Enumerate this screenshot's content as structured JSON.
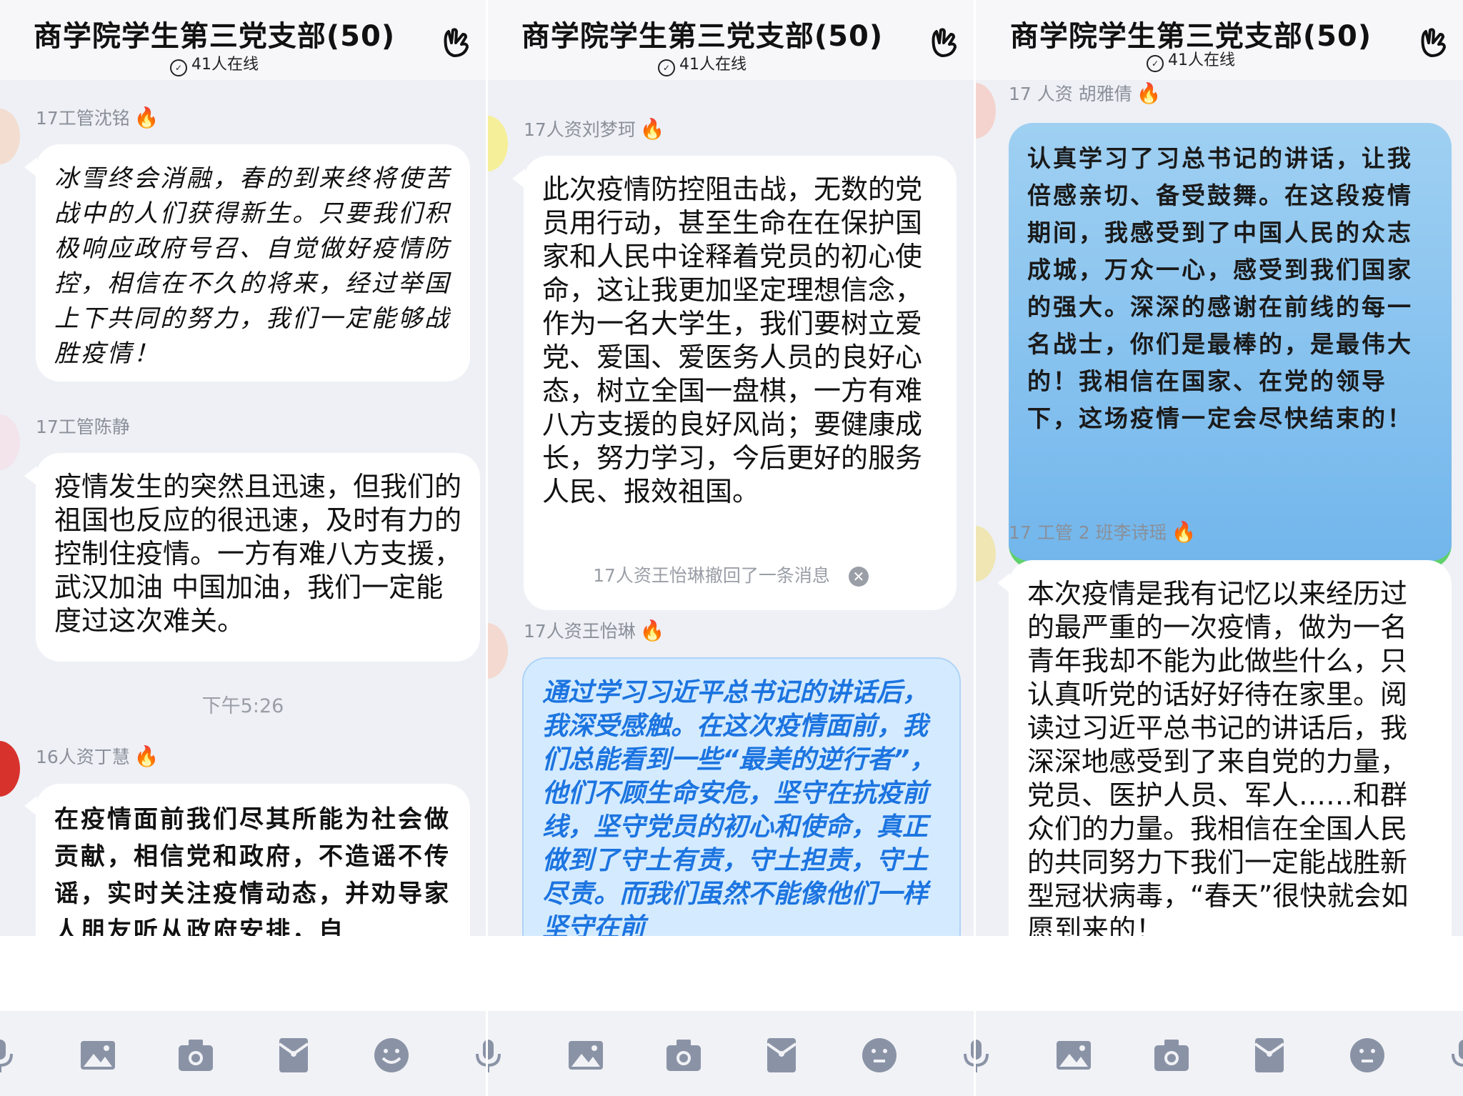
{
  "panels": [
    {
      "title": "商学院学生第三党支部(50)",
      "online": "41人在线",
      "messages": [
        {
          "sender": "17工管沈铭",
          "text": "冰雪终会消融，春的到来终将使苦战中的人们获得新生。只要我们积极响应政府号召、自觉做好疫情防控，相信在不久的将来，经过举国上下共同的努力，我们一定能够战胜疫情！"
        },
        {
          "sender": "17工管陈静",
          "text": "疫情发生的突然且迅速，但我们的祖国也反应的很迅速，及时有力的控制住疫情。一方有难八方支援，武汉加油 中国加油，我们一定能度过这次难关。"
        },
        {
          "sender": "16人资丁慧",
          "text": "在疫情面前我们尽其所能为社会做贡献，相信党和政府，不造谣不传谣，实时关注疫情动态，并劝导家人朋友听从政府安排，自"
        }
      ],
      "time": "下午5:26"
    },
    {
      "title": "商学院学生第三党支部(50)",
      "online": "41人在线",
      "messages": [
        {
          "sender": "17人资刘梦珂",
          "text": "此次疫情防控阻击战，无数的党员用行动，甚至生命在在保护国家和人民中诠释着党员的初心使命，这让我更加坚定理想信念，作为一名大学生，我们要树立爱党、爱国、爱医务人员的良好心态，树立全国一盘棋，一方有难八方支援的良好风尚；要健康成长，努力学习，今后更好的服务人民、报效祖国。"
        },
        {
          "sender": "17人资王怡琳",
          "text": "通过学习习近平总书记的讲话后，我深受感触。在这次疫情面前，我们总能看到一些“最美的逆行者”，他们不顾生命安危，坚守在抗疫前线，坚守党员的初心和使命，真正做到了守土有责，守土担责，守土尽责。而我们虽然不能像他们一样坚守在前"
        }
      ],
      "recall": "17人资王怡琳撤回了一条消息"
    },
    {
      "title": "商学院学生第三党支部(50)",
      "online": "41人在线",
      "messages": [
        {
          "sender": "17 人资 胡雅倩",
          "text": "认真学习了习总书记的讲话，让我倍感亲切、备受鼓舞。在这段疫情期间，我感受到了中国人民的众志成城，万众一心，感受到我们国家的强大。深深的感谢在前线的每一名战士，你们是最棒的，是最伟大的！我相信在国家、在党的领导下，这场疫情一定会尽快结束的！"
        },
        {
          "sender": "17 工管 2 班李诗瑶",
          "text": "本次疫情是我有记忆以来经历过的最严重的一次疫情，做为一名青年我却不能为此做些什么，只认真听党的话好好待在家里。阅读过习近平总书记的讲话后，我深深地感受到了来自党的力量，党员、医护人员、军人……和群众们的力量。我相信在全国人民的共同努力下我们一定能战胜新型冠状病毒，“春天”很快就会如愿到来的！"
        }
      ]
    }
  ],
  "toolbar_icons": [
    "microphone-icon",
    "image-icon",
    "camera-icon",
    "red-packet-icon",
    "emoji-icon"
  ],
  "colors": {
    "fire": "#ff5a1f",
    "blue_text": "#1c74e0",
    "green_border": "#5fd06b"
  }
}
